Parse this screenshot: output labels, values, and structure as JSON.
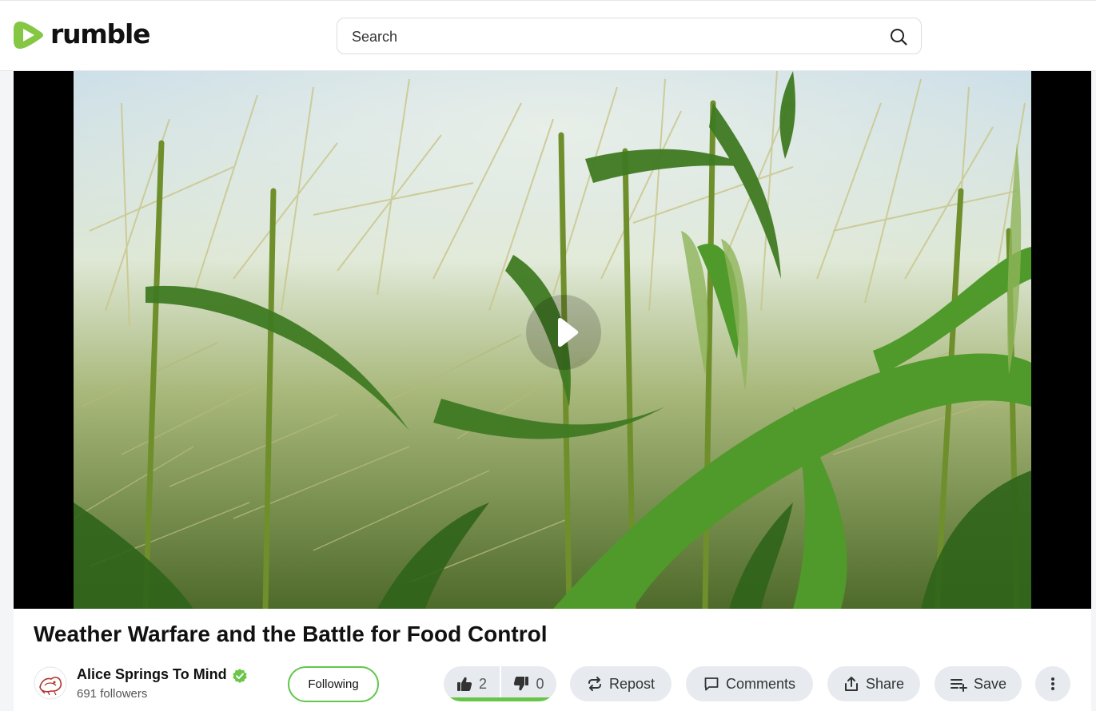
{
  "header": {
    "logo_text": "rumble",
    "search_placeholder": "Search"
  },
  "video": {
    "title": "Weather Warfare and the Battle for Food Control"
  },
  "channel": {
    "name": "Alice Springs To Mind",
    "followers": "691 followers",
    "follow_label": "Following"
  },
  "votes": {
    "up": "2",
    "down": "0",
    "up_fraction": 1.0
  },
  "actions": {
    "repost": "Repost",
    "comments": "Comments",
    "share": "Share",
    "save": "Save"
  },
  "colors": {
    "brand": "#85c742",
    "accent_green": "#69c548",
    "pill_bg": "#e7ebef"
  },
  "icons": [
    "search-icon",
    "play-icon",
    "verified-icon",
    "thumbs-up-icon",
    "thumbs-down-icon",
    "repost-icon",
    "comment-icon",
    "share-icon",
    "save-playlist-icon",
    "more-vertical-icon"
  ]
}
